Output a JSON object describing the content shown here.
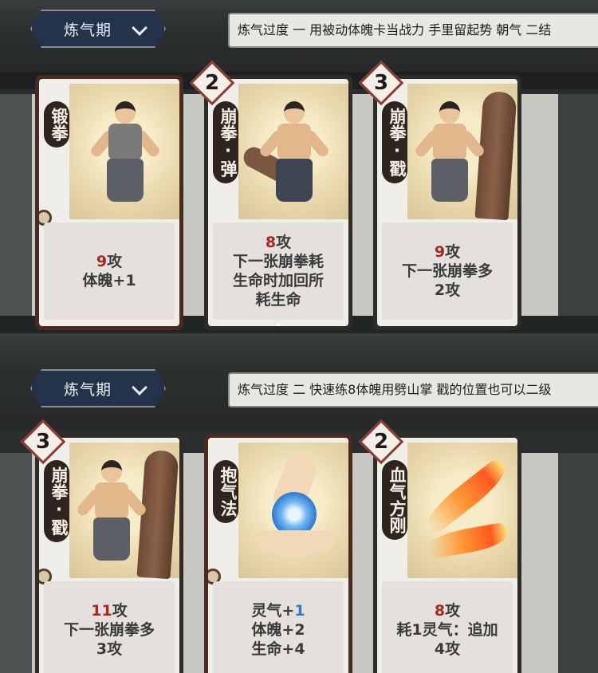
{
  "rows": [
    {
      "stage": "炼气期",
      "tip": "炼气过度 一 用被动体魄卡当战力 手里留起势 朝气 二结",
      "cards": [
        {
          "cost": "",
          "name": "锻拳",
          "line1_dmg": "9",
          "line1_suffix": "攻",
          "line2": "体魄+1",
          "line3": "",
          "line4": ""
        },
        {
          "cost": "2",
          "name": "崩拳·弹",
          "line1_dmg": "8",
          "line1_suffix": "攻",
          "line2": "下一张崩拳耗",
          "line3": "生命时加回所",
          "line4": "耗生命"
        },
        {
          "cost": "3",
          "name": "崩拳·戳",
          "line1_dmg": "9",
          "line1_suffix": "攻",
          "line2": "下一张崩拳多",
          "line3": "2攻",
          "line4": ""
        }
      ]
    },
    {
      "stage": "炼气期",
      "tip": "炼气过度 二 快速练8体魄用劈山掌 戳的位置也可以二级",
      "cards": [
        {
          "cost": "3",
          "name": "崩拳·戳",
          "line1_dmg": "11",
          "line1_suffix": "攻",
          "line2": "下一张崩拳多",
          "line3": "3攻",
          "line4": ""
        },
        {
          "cost": "",
          "name": "抱气法",
          "line1_pre": "灵气+",
          "line1_blue": "1",
          "line2": "体魄+2",
          "line3": "生命+4"
        },
        {
          "cost": "2",
          "name": "血气方刚",
          "line1_dmg": "8",
          "line1_suffix": "攻",
          "line2": "耗1灵气：追加",
          "line3": "4攻",
          "line4": ""
        }
      ]
    }
  ],
  "icons": [
    "chevron-down-icon"
  ],
  "colors": {
    "damage": "#a6281f",
    "qi": "#2f79c6",
    "stage_bg": "#23344a"
  }
}
